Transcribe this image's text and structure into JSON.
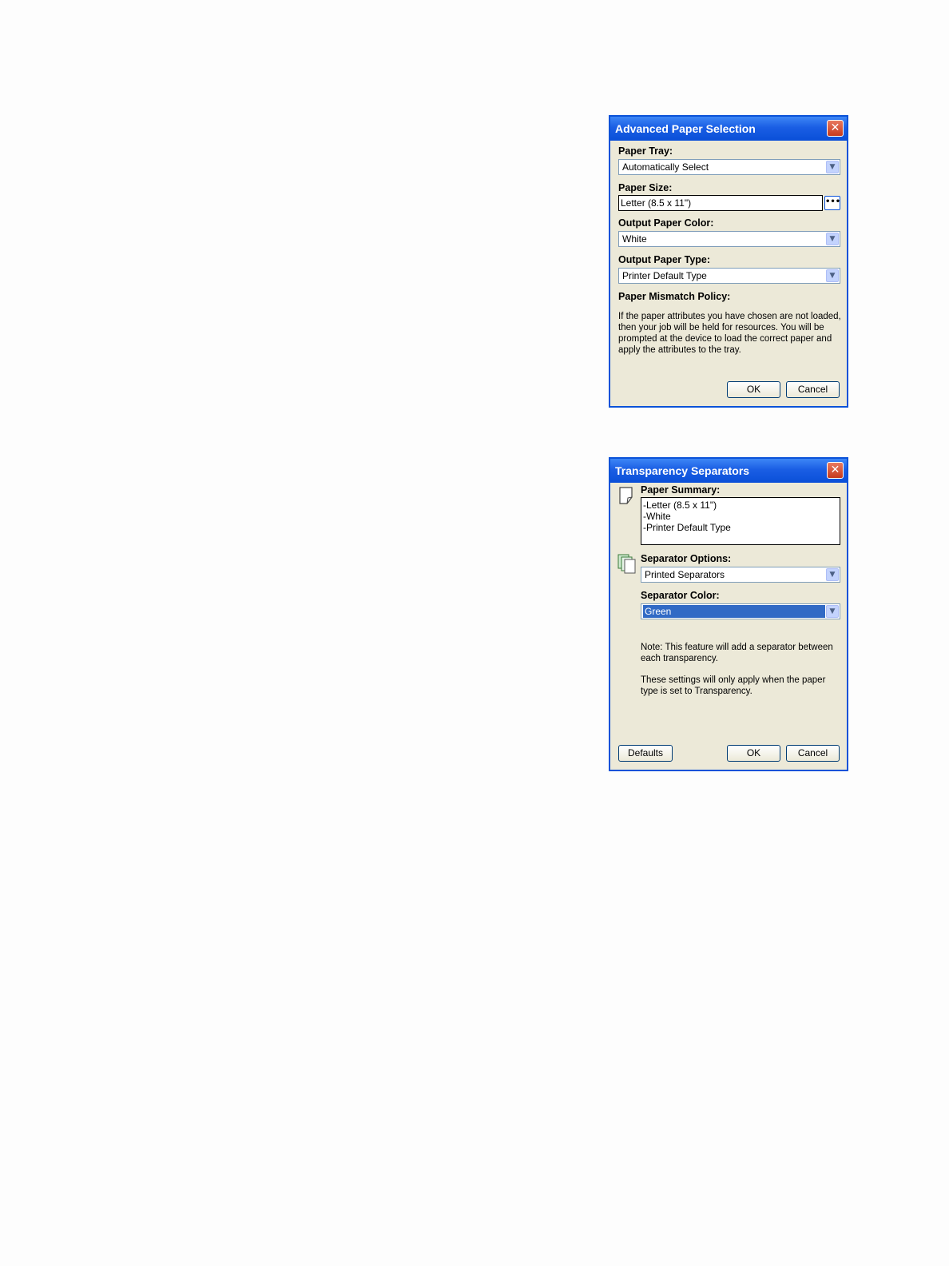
{
  "advanced": {
    "title": "Advanced Paper Selection",
    "close_icon": "close-icon",
    "paper_tray_label": "Paper Tray:",
    "paper_tray_value": "Automatically Select",
    "paper_size_label": "Paper Size:",
    "paper_size_value": "Letter (8.5 x 11\")",
    "paper_size_button": "•••",
    "output_color_label": "Output Paper Color:",
    "output_color_value": "White",
    "output_type_label": "Output Paper Type:",
    "output_type_value": "Printer Default Type",
    "mismatch_label": "Paper Mismatch Policy:",
    "mismatch_text": "If the paper attributes you have chosen are not loaded, then your job will be held for resources.  You will be prompted at the device to load the correct paper and apply the attributes to the tray.",
    "ok_label": "OK",
    "cancel_label": "Cancel"
  },
  "transparency": {
    "title": "Transparency Separators",
    "close_icon": "close-icon",
    "summary_icon": "page-icon",
    "summary_label": "Paper Summary:",
    "summary_lines": [
      "-Letter (8.5 x 11\")",
      "-White",
      "-Printer Default Type"
    ],
    "options_icon": "stacked-pages-icon",
    "options_label": "Separator Options:",
    "options_value": "Printed Separators",
    "color_label": "Separator Color:",
    "color_value": "Green",
    "note_text": "Note: This feature will add a separator between each transparency.",
    "settings_text": "These settings will only apply when the paper type is set to Transparency.",
    "defaults_label": "Defaults",
    "ok_label": "OK",
    "cancel_label": "Cancel"
  },
  "colors": {
    "title_bar": "#0a52d8",
    "dialog_bg": "#ece9d8",
    "selection": "#316ac5",
    "close_button": "#c63a1c"
  }
}
